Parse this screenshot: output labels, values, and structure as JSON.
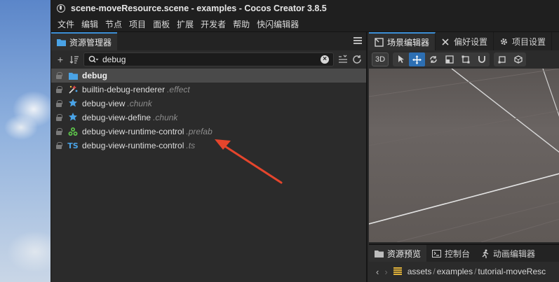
{
  "window": {
    "title": "scene-moveResource.scene - examples - Cocos Creator 3.8.5"
  },
  "menu": [
    "文件",
    "编辑",
    "节点",
    "项目",
    "面板",
    "扩展",
    "开发者",
    "帮助",
    "快闪编辑器"
  ],
  "asset_panel": {
    "tab_label": "资源管理器",
    "search_value": "debug",
    "items": [
      {
        "name": "debug",
        "ext": "",
        "icon": "folder-icon",
        "selected": true
      },
      {
        "name": "builtin-debug-renderer",
        "ext": ".effect",
        "icon": "effect-icon",
        "selected": false
      },
      {
        "name": "debug-view",
        "ext": ".chunk",
        "icon": "chunk-icon",
        "selected": false
      },
      {
        "name": "debug-view-define",
        "ext": ".chunk",
        "icon": "chunk-icon",
        "selected": false
      },
      {
        "name": "debug-view-runtime-control",
        "ext": ".prefab",
        "icon": "prefab-icon",
        "selected": false
      },
      {
        "name": "debug-view-runtime-control",
        "ext": ".ts",
        "icon": "typescript-icon",
        "selected": false
      }
    ]
  },
  "scene_panel": {
    "tabs": [
      "场景编辑器",
      "偏好设置",
      "项目设置"
    ],
    "mode_button": "3D"
  },
  "bottom_panel": {
    "tabs": [
      "资源预览",
      "控制台",
      "动画编辑器"
    ],
    "breadcrumb": [
      "assets",
      "examples",
      "tutorial-moveResc"
    ]
  },
  "colors": {
    "accent": "#3d8fd6",
    "folder": "#4aa3e6",
    "chunk": "#4aa3e6",
    "prefab": "#5cbf4a",
    "typescript": "#4aa3e6",
    "annotation_arrow": "#e5452c"
  }
}
